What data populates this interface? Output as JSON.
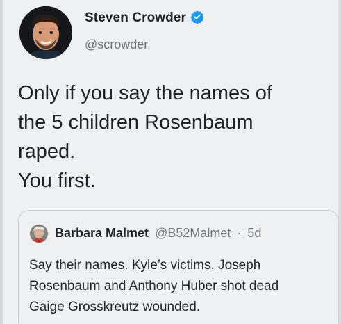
{
  "tweet": {
    "author": {
      "name": "Steven Crowder",
      "handle": "@scrowder",
      "verified": true,
      "verified_color": "#1d9bf0"
    },
    "text_lines": [
      "Only if you say the names of",
      "the 5 children Rosenbaum",
      "raped.",
      "You first."
    ]
  },
  "quoted_tweet": {
    "author": {
      "name": "Barbara Malmet",
      "handle": "@B52Malmet",
      "separator": "·",
      "time": "5d"
    },
    "text_lines": [
      "Say their names. Kyle’s victims. Joseph",
      "Rosenbaum and Anthony Huber shot dead",
      "Gaige Grosskreutz wounded."
    ]
  },
  "icons": {
    "verified": "verified-badge-icon"
  }
}
